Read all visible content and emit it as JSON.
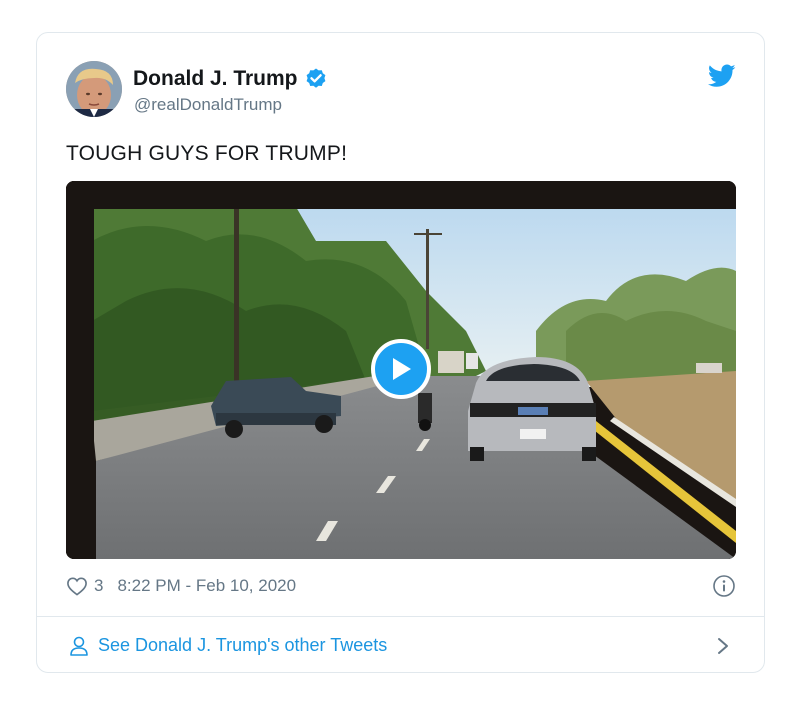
{
  "tweet": {
    "author": {
      "display_name": "Donald J. Trump",
      "handle": "@realDonaldTrump",
      "verified": true
    },
    "text": "TOUGH GUYS FOR TRUMP!",
    "media": {
      "type": "video",
      "play_icon": "play-icon"
    },
    "likes": "3",
    "timestamp": "8:22 PM - Feb 10, 2020"
  },
  "footer": {
    "other_tweets_label": "See Donald J. Trump's other Tweets"
  },
  "icons": {
    "brand": "twitter-bird-icon",
    "verified": "verified-badge-icon",
    "like": "heart-icon",
    "info": "info-icon",
    "profile": "person-icon",
    "chevron": "chevron-right-icon"
  },
  "colors": {
    "brand_blue": "#1da1f2",
    "link_blue": "#1b95e0",
    "secondary_text": "#657786",
    "border": "#e1e8ed"
  }
}
